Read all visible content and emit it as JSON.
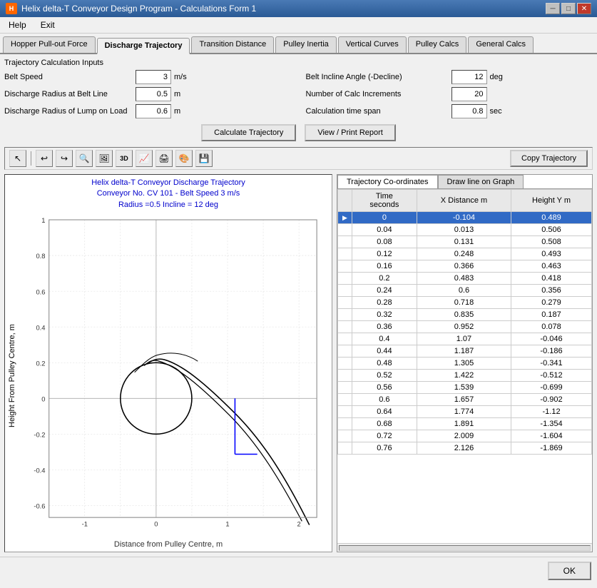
{
  "window": {
    "title": "Helix delta-T Conveyor Design Program - Calculations Form 1"
  },
  "menu": {
    "items": [
      "Help",
      "Exit"
    ]
  },
  "tabs": [
    {
      "label": "Hopper Pull-out Force",
      "active": false
    },
    {
      "label": "Discharge Trajectory",
      "active": true
    },
    {
      "label": "Transition Distance",
      "active": false
    },
    {
      "label": "Pulley Inertia",
      "active": false
    },
    {
      "label": "Vertical Curves",
      "active": false
    },
    {
      "label": "Pulley Calcs",
      "active": false
    },
    {
      "label": "General Calcs",
      "active": false
    }
  ],
  "section": {
    "title": "Trajectory Calculation Inputs"
  },
  "inputs": {
    "belt_speed": {
      "label": "Belt Speed",
      "value": "3",
      "unit": "m/s"
    },
    "discharge_radius": {
      "label": "Discharge Radius at Belt Line",
      "value": "0.5",
      "unit": "m"
    },
    "discharge_lump": {
      "label": "Discharge Radius of Lump on Load",
      "value": "0.6",
      "unit": "m"
    },
    "belt_incline": {
      "label": "Belt Incline Angle (-Decline)",
      "value": "12",
      "unit": "deg"
    },
    "calc_increments": {
      "label": "Number of Calc Increments",
      "value": "20",
      "unit": ""
    },
    "calc_time": {
      "label": "Calculation time span",
      "value": "0.8",
      "unit": "sec"
    }
  },
  "buttons": {
    "calculate": "Calculate Trajectory",
    "view_print": "View / Print Report",
    "copy": "Copy Trajectory"
  },
  "chart": {
    "title_line1": "Helix delta-T Conveyor Discharge Trajectory",
    "title_line2": "Conveyor No. CV 101 - Belt Speed 3 m/s",
    "title_line3": "Radius =0.5 Incline = 12 deg",
    "x_label": "Distance from Pulley Centre, m",
    "y_label": "Height From Pulley Centre, m"
  },
  "data_panel": {
    "tabs": [
      "Trajectory Co-ordinates",
      "Draw line on Graph"
    ],
    "active_tab": "Trajectory Co-ordinates",
    "columns": [
      "Time\nseconds",
      "X Distance m",
      "Height Y m"
    ],
    "rows": [
      {
        "time": "0",
        "x": "-0.104",
        "y": "0.489",
        "selected": true
      },
      {
        "time": "0.04",
        "x": "0.013",
        "y": "0.506",
        "selected": false
      },
      {
        "time": "0.08",
        "x": "0.131",
        "y": "0.508",
        "selected": false
      },
      {
        "time": "0.12",
        "x": "0.248",
        "y": "0.493",
        "selected": false
      },
      {
        "time": "0.16",
        "x": "0.366",
        "y": "0.463",
        "selected": false
      },
      {
        "time": "0.2",
        "x": "0.483",
        "y": "0.418",
        "selected": false
      },
      {
        "time": "0.24",
        "x": "0.6",
        "y": "0.356",
        "selected": false
      },
      {
        "time": "0.28",
        "x": "0.718",
        "y": "0.279",
        "selected": false
      },
      {
        "time": "0.32",
        "x": "0.835",
        "y": "0.187",
        "selected": false
      },
      {
        "time": "0.36",
        "x": "0.952",
        "y": "0.078",
        "selected": false
      },
      {
        "time": "0.4",
        "x": "1.07",
        "y": "-0.046",
        "selected": false
      },
      {
        "time": "0.44",
        "x": "1.187",
        "y": "-0.186",
        "selected": false
      },
      {
        "time": "0.48",
        "x": "1.305",
        "y": "-0.341",
        "selected": false
      },
      {
        "time": "0.52",
        "x": "1.422",
        "y": "-0.512",
        "selected": false
      },
      {
        "time": "0.56",
        "x": "1.539",
        "y": "-0.699",
        "selected": false
      },
      {
        "time": "0.6",
        "x": "1.657",
        "y": "-0.902",
        "selected": false
      },
      {
        "time": "0.64",
        "x": "1.774",
        "y": "-1.12",
        "selected": false
      },
      {
        "time": "0.68",
        "x": "1.891",
        "y": "-1.354",
        "selected": false
      },
      {
        "time": "0.72",
        "x": "2.009",
        "y": "-1.604",
        "selected": false
      },
      {
        "time": "0.76",
        "x": "2.126",
        "y": "-1.869",
        "selected": false
      }
    ]
  },
  "footer": {
    "ok_label": "OK"
  },
  "icons": {
    "undo": "↩",
    "redo": "↪",
    "zoom_in": "🔍",
    "image": "🖼",
    "3d": "3D",
    "chart": "📈",
    "print": "🖨",
    "color": "🎨",
    "save": "💾",
    "pointer": "↖"
  }
}
